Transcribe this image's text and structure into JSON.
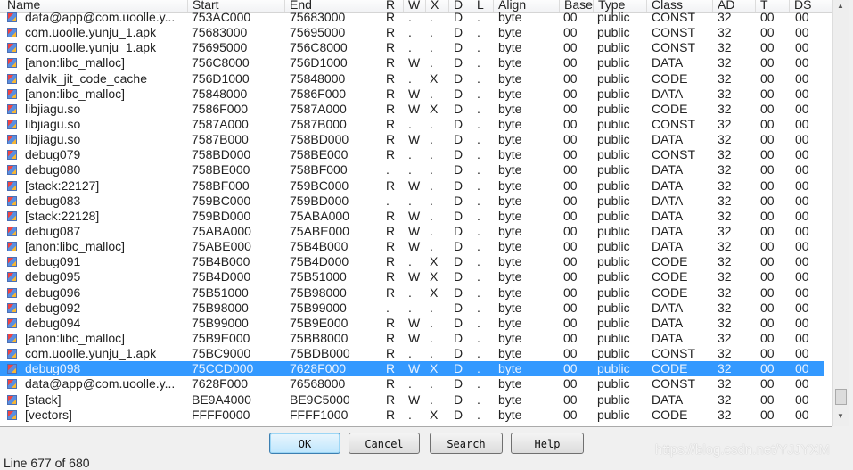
{
  "columns": [
    "Name",
    "Start",
    "End",
    "R",
    "W",
    "X",
    "D",
    "L",
    "Align",
    "Base",
    "Type",
    "Class",
    "AD",
    "T",
    "DS"
  ],
  "rows": [
    [
      "data@app@com.uoolle.y...",
      "753AC000",
      "75683000",
      "R",
      ".",
      ".",
      "D",
      ".",
      "byte",
      "00",
      "public",
      "CONST",
      "32",
      "00",
      "00"
    ],
    [
      "com.uoolle.yunju_1.apk",
      "75683000",
      "75695000",
      "R",
      ".",
      ".",
      "D",
      ".",
      "byte",
      "00",
      "public",
      "CONST",
      "32",
      "00",
      "00"
    ],
    [
      "com.uoolle.yunju_1.apk",
      "75695000",
      "756C8000",
      "R",
      ".",
      ".",
      "D",
      ".",
      "byte",
      "00",
      "public",
      "CONST",
      "32",
      "00",
      "00"
    ],
    [
      "[anon:libc_malloc]",
      "756C8000",
      "756D1000",
      "R",
      "W",
      ".",
      "D",
      ".",
      "byte",
      "00",
      "public",
      "DATA",
      "32",
      "00",
      "00"
    ],
    [
      "dalvik_jit_code_cache",
      "756D1000",
      "75848000",
      "R",
      ".",
      "X",
      "D",
      ".",
      "byte",
      "00",
      "public",
      "CODE",
      "32",
      "00",
      "00"
    ],
    [
      "[anon:libc_malloc]",
      "75848000",
      "7586F000",
      "R",
      "W",
      ".",
      "D",
      ".",
      "byte",
      "00",
      "public",
      "DATA",
      "32",
      "00",
      "00"
    ],
    [
      "libjiagu.so",
      "7586F000",
      "7587A000",
      "R",
      "W",
      "X",
      "D",
      ".",
      "byte",
      "00",
      "public",
      "CODE",
      "32",
      "00",
      "00"
    ],
    [
      "libjiagu.so",
      "7587A000",
      "7587B000",
      "R",
      ".",
      ".",
      "D",
      ".",
      "byte",
      "00",
      "public",
      "CONST",
      "32",
      "00",
      "00"
    ],
    [
      "libjiagu.so",
      "7587B000",
      "758BD000",
      "R",
      "W",
      ".",
      "D",
      ".",
      "byte",
      "00",
      "public",
      "DATA",
      "32",
      "00",
      "00"
    ],
    [
      "debug079",
      "758BD000",
      "758BE000",
      "R",
      ".",
      ".",
      "D",
      ".",
      "byte",
      "00",
      "public",
      "CONST",
      "32",
      "00",
      "00"
    ],
    [
      "debug080",
      "758BE000",
      "758BF000",
      ".",
      ".",
      ".",
      "D",
      ".",
      "byte",
      "00",
      "public",
      "DATA",
      "32",
      "00",
      "00"
    ],
    [
      "[stack:22127]",
      "758BF000",
      "759BC000",
      "R",
      "W",
      ".",
      "D",
      ".",
      "byte",
      "00",
      "public",
      "DATA",
      "32",
      "00",
      "00"
    ],
    [
      "debug083",
      "759BC000",
      "759BD000",
      ".",
      ".",
      ".",
      "D",
      ".",
      "byte",
      "00",
      "public",
      "DATA",
      "32",
      "00",
      "00"
    ],
    [
      "[stack:22128]",
      "759BD000",
      "75ABA000",
      "R",
      "W",
      ".",
      "D",
      ".",
      "byte",
      "00",
      "public",
      "DATA",
      "32",
      "00",
      "00"
    ],
    [
      "debug087",
      "75ABA000",
      "75ABE000",
      "R",
      "W",
      ".",
      "D",
      ".",
      "byte",
      "00",
      "public",
      "DATA",
      "32",
      "00",
      "00"
    ],
    [
      "[anon:libc_malloc]",
      "75ABE000",
      "75B4B000",
      "R",
      "W",
      ".",
      "D",
      ".",
      "byte",
      "00",
      "public",
      "DATA",
      "32",
      "00",
      "00"
    ],
    [
      "debug091",
      "75B4B000",
      "75B4D000",
      "R",
      ".",
      "X",
      "D",
      ".",
      "byte",
      "00",
      "public",
      "CODE",
      "32",
      "00",
      "00"
    ],
    [
      "debug095",
      "75B4D000",
      "75B51000",
      "R",
      "W",
      "X",
      "D",
      ".",
      "byte",
      "00",
      "public",
      "CODE",
      "32",
      "00",
      "00"
    ],
    [
      "debug096",
      "75B51000",
      "75B98000",
      "R",
      ".",
      "X",
      "D",
      ".",
      "byte",
      "00",
      "public",
      "CODE",
      "32",
      "00",
      "00"
    ],
    [
      "debug092",
      "75B98000",
      "75B99000",
      ".",
      ".",
      ".",
      "D",
      ".",
      "byte",
      "00",
      "public",
      "DATA",
      "32",
      "00",
      "00"
    ],
    [
      "debug094",
      "75B99000",
      "75B9E000",
      "R",
      "W",
      ".",
      "D",
      ".",
      "byte",
      "00",
      "public",
      "DATA",
      "32",
      "00",
      "00"
    ],
    [
      "[anon:libc_malloc]",
      "75B9E000",
      "75BB8000",
      "R",
      "W",
      ".",
      "D",
      ".",
      "byte",
      "00",
      "public",
      "DATA",
      "32",
      "00",
      "00"
    ],
    [
      "com.uoolle.yunju_1.apk",
      "75BC9000",
      "75BDB000",
      "R",
      ".",
      ".",
      "D",
      ".",
      "byte",
      "00",
      "public",
      "CONST",
      "32",
      "00",
      "00"
    ],
    [
      "debug098",
      "75CCD000",
      "7628F000",
      "R",
      "W",
      "X",
      "D",
      ".",
      "byte",
      "00",
      "public",
      "CODE",
      "32",
      "00",
      "00"
    ],
    [
      "data@app@com.uoolle.y...",
      "7628F000",
      "76568000",
      "R",
      ".",
      ".",
      "D",
      ".",
      "byte",
      "00",
      "public",
      "CONST",
      "32",
      "00",
      "00"
    ],
    [
      "[stack]",
      "BE9A4000",
      "BE9C5000",
      "R",
      "W",
      ".",
      "D",
      ".",
      "byte",
      "00",
      "public",
      "DATA",
      "32",
      "00",
      "00"
    ],
    [
      "[vectors]",
      "FFFF0000",
      "FFFF1000",
      "R",
      ".",
      "X",
      "D",
      ".",
      "byte",
      "00",
      "public",
      "CODE",
      "32",
      "00",
      "00"
    ]
  ],
  "selected_row": 23,
  "buttons": {
    "ok": "OK",
    "cancel": "Cancel",
    "search": "Search",
    "help": "Help"
  },
  "status": "Line 677 of 680",
  "watermark": "https://blog.csdn.net/YJJYXM",
  "colors": {
    "selection": "#3399ff"
  }
}
